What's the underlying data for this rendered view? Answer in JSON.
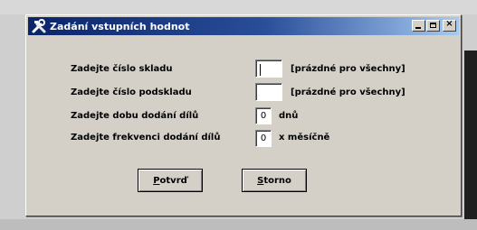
{
  "window": {
    "title": "Zadání vstupních hodnot",
    "icon": "tools-icon"
  },
  "form": {
    "rows": [
      {
        "label": "Zadejte číslo skladu",
        "value": "",
        "hint": "[prázdné pro všechny]"
      },
      {
        "label": "Zadejte číslo podskladu",
        "value": "",
        "hint": "[prázdné pro všechny]"
      },
      {
        "label": "Zadejte dobu dodání dílů",
        "value": "0",
        "hint": "dnů"
      },
      {
        "label": "Zadejte frekvenci dodání dílů",
        "value": "0",
        "hint": "x měsíčně"
      }
    ]
  },
  "buttons": {
    "confirm_first": "P",
    "confirm_rest": "otvrď",
    "cancel_first": "S",
    "cancel_rest": "torno"
  }
}
